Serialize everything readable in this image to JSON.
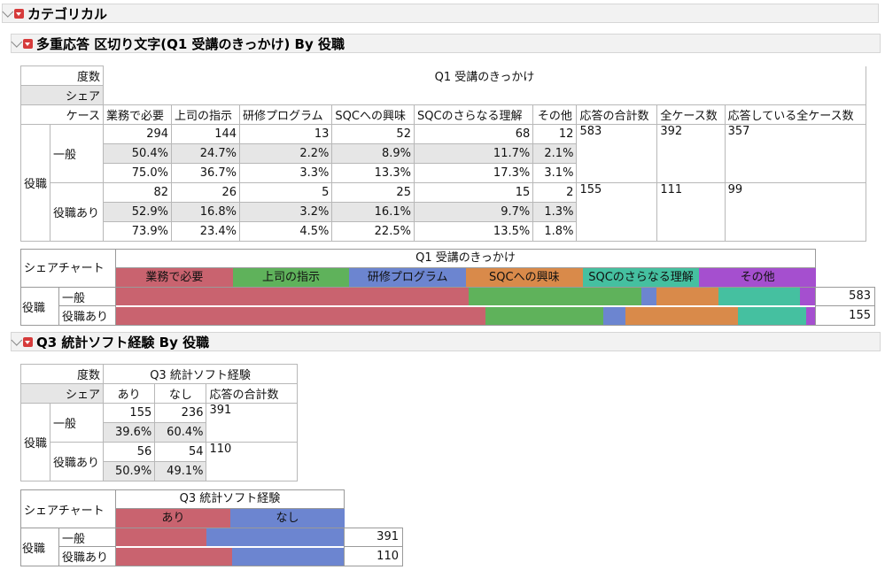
{
  "report_title": "カテゴリカル",
  "section1": {
    "title": "多重応答 区切り文字(Q1 受講のきっかけ) By 役職",
    "stat_labels": [
      "度数",
      "シェア",
      "ケース"
    ],
    "col_group": "Q1 受講のきっかけ",
    "columns": [
      "業務で必要",
      "上司の指示",
      "研修プログラム",
      "SQCへの興味",
      "SQCのさらなる理解",
      "その他",
      "応答の合計数",
      "全ケース数",
      "応答している全ケース数"
    ],
    "row_var": "役職",
    "rows": [
      {
        "label": "一般",
        "count": [
          "294",
          "144",
          "13",
          "52",
          "68",
          "12"
        ],
        "share": [
          "50.4%",
          "24.7%",
          "2.2%",
          "8.9%",
          "11.7%",
          "2.1%"
        ],
        "cases": [
          "75.0%",
          "36.7%",
          "3.3%",
          "13.3%",
          "17.3%",
          "3.1%"
        ],
        "total_responses": "583",
        "total_cases": "392",
        "responding_cases": "357"
      },
      {
        "label": "役職あり",
        "count": [
          "82",
          "26",
          "5",
          "25",
          "15",
          "2"
        ],
        "share": [
          "52.9%",
          "16.8%",
          "3.2%",
          "16.1%",
          "9.7%",
          "1.3%"
        ],
        "cases": [
          "73.9%",
          "23.4%",
          "4.5%",
          "22.5%",
          "13.5%",
          "1.8%"
        ],
        "total_responses": "155",
        "total_cases": "111",
        "responding_cases": "99"
      }
    ],
    "share_chart": {
      "label": "シェアチャート",
      "group": "Q1 受講のきっかけ",
      "row_var": "役職",
      "legend": [
        "業務で必要",
        "上司の指示",
        "研修プログラム",
        "SQCへの興味",
        "SQCのさらなる理解",
        "その他"
      ],
      "colors": [
        "#c9636f",
        "#5fb25b",
        "#6c85d0",
        "#d98a4a",
        "#45c0a0",
        "#a54fcf"
      ],
      "rows": [
        {
          "label": "一般",
          "shares": [
            0.504,
            0.247,
            0.022,
            0.089,
            0.117,
            0.021
          ],
          "total": "583"
        },
        {
          "label": "役職あり",
          "shares": [
            0.529,
            0.168,
            0.032,
            0.161,
            0.097,
            0.013
          ],
          "total": "155"
        }
      ]
    }
  },
  "section2": {
    "title": "Q3 統計ソフト経験 By 役職",
    "stat_labels": [
      "度数",
      "シェア"
    ],
    "col_group": "Q3 統計ソフト経験",
    "columns": [
      "あり",
      "なし",
      "応答の合計数"
    ],
    "row_var": "役職",
    "rows": [
      {
        "label": "一般",
        "count": [
          "155",
          "236"
        ],
        "share": [
          "39.6%",
          "60.4%"
        ],
        "total": "391"
      },
      {
        "label": "役職あり",
        "count": [
          "56",
          "54"
        ],
        "share": [
          "50.9%",
          "49.1%"
        ],
        "total": "110"
      }
    ],
    "share_chart": {
      "label": "シェアチャート",
      "group": "Q3 統計ソフト経験",
      "row_var": "役職",
      "legend": [
        "あり",
        "なし"
      ],
      "colors": [
        "#c9636f",
        "#6c85d0"
      ],
      "rows": [
        {
          "label": "一般",
          "shares": [
            0.396,
            0.604
          ],
          "total": "391"
        },
        {
          "label": "役職あり",
          "shares": [
            0.509,
            0.491
          ],
          "total": "110"
        }
      ]
    }
  }
}
